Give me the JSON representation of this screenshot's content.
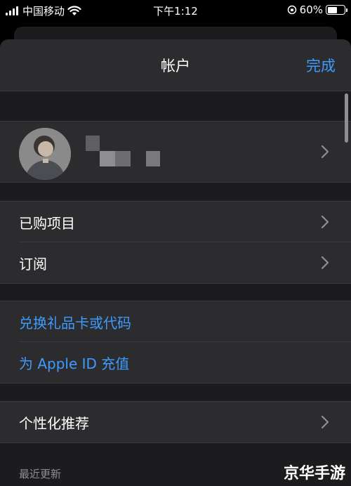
{
  "status_bar": {
    "carrier": "中国移动",
    "time": "下午1:12",
    "battery_percent": "60%",
    "battery_level": 0.6
  },
  "nav": {
    "title": "帐户",
    "done_label": "完成"
  },
  "menu": {
    "purchased": "已购项目",
    "subscriptions": "订阅",
    "redeem": "兑换礼品卡或代码",
    "add_funds": "为 Apple ID 充值",
    "personalized": "个性化推荐"
  },
  "footer": {
    "recent_updates": "最近更新"
  },
  "watermark": "京华手游",
  "colors": {
    "accent": "#3d9bff",
    "background": "#1c1c1e",
    "cell": "#2c2c2e"
  }
}
